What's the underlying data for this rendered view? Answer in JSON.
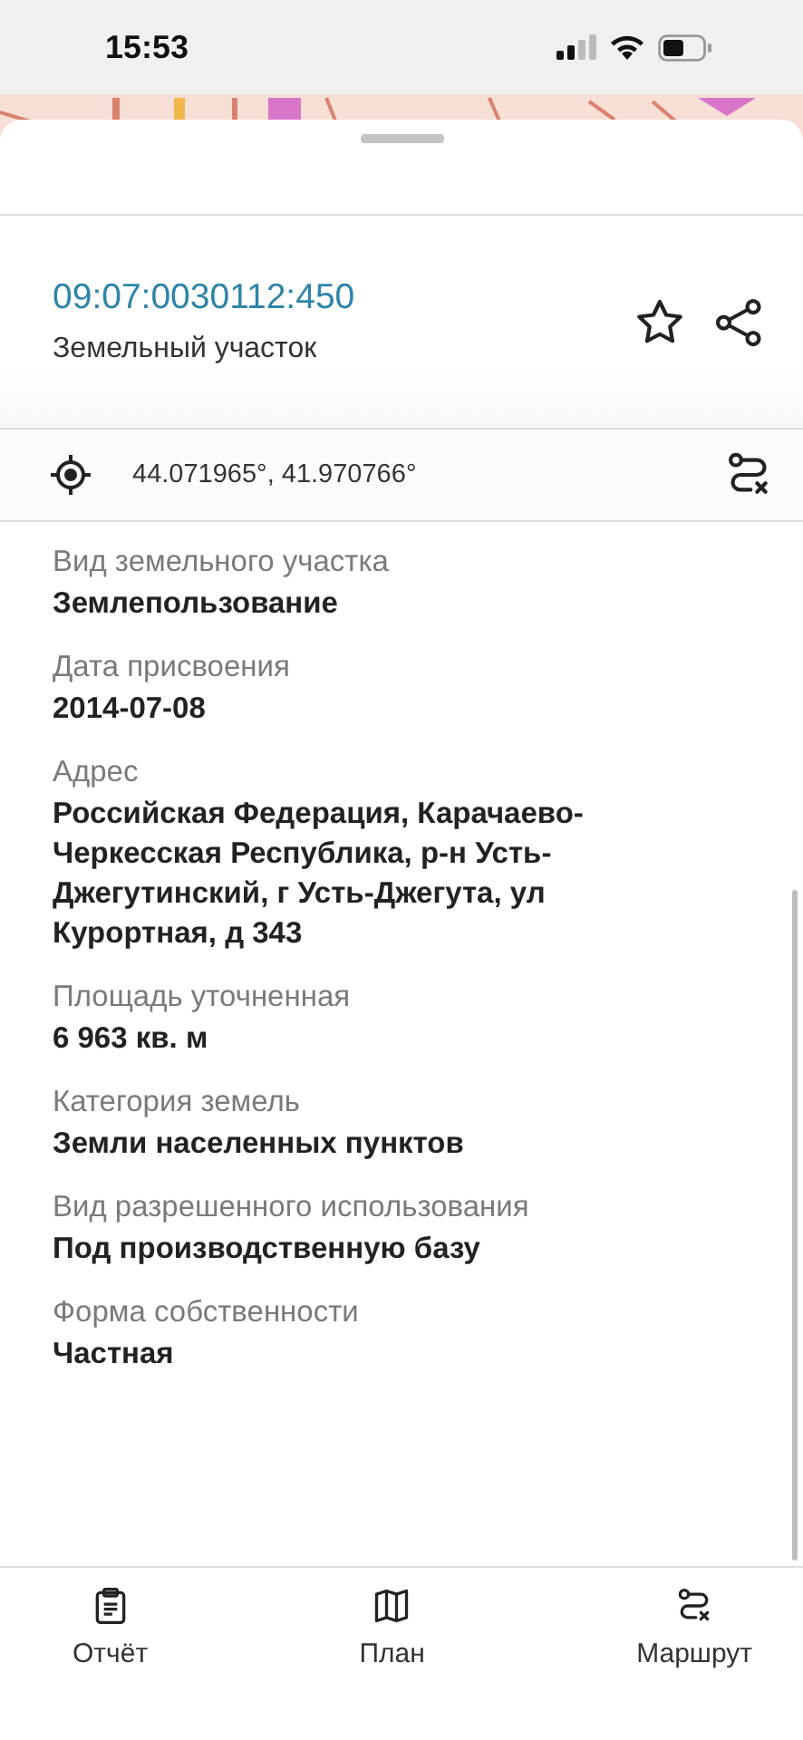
{
  "status_bar": {
    "time": "15:53"
  },
  "sheet": {
    "title": "09:07:0030112:450",
    "subtitle": "Земельный участок",
    "favorite": false,
    "coordinates": "44.071965°, 41.970766°"
  },
  "fields": [
    {
      "label": "Вид земельного участка",
      "value": "Землепользование"
    },
    {
      "label": "Дата присвоения",
      "value": "2014-07-08"
    },
    {
      "label": "Адрес",
      "value": "Российская Федерация, Карачаево-Черкесская Республика, р-н Усть-Джегутинский, г Усть-Джегута, ул Курортная, д 343"
    },
    {
      "label": "Площадь уточненная",
      "value": "6 963 кв. м"
    },
    {
      "label": "Категория земель",
      "value": "Земли населенных пунктов"
    },
    {
      "label": "Вид разрешенного использования",
      "value": "Под производственную базу"
    },
    {
      "label": "Форма собственности",
      "value": "Частная"
    }
  ],
  "tab_bar": [
    {
      "kind": "report",
      "label": "Отчёт"
    },
    {
      "kind": "plan",
      "label": "План"
    },
    {
      "kind": "route",
      "label": "Маршрут"
    }
  ]
}
